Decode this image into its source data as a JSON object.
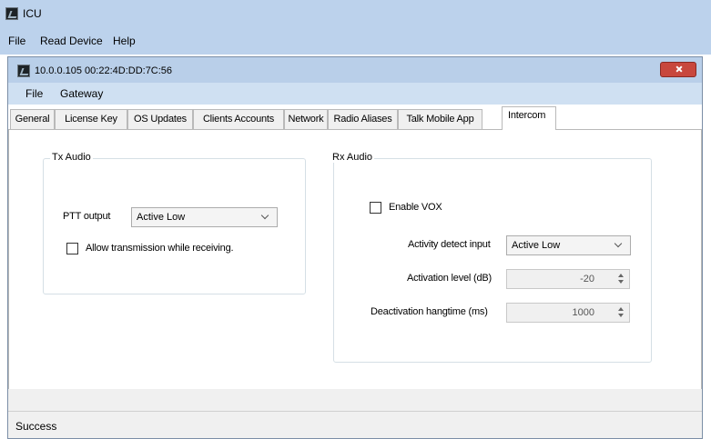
{
  "outer_window": {
    "title": "ICU",
    "menu": [
      "File",
      "Read Device",
      "Help"
    ]
  },
  "inner_window": {
    "title": "10.0.0.105    00:22:4D:DD:7C:56",
    "menu": [
      "File",
      "Gateway"
    ]
  },
  "tabs": [
    {
      "label": "General"
    },
    {
      "label": "License Key"
    },
    {
      "label": "OS Updates"
    },
    {
      "label": "Clients Accounts"
    },
    {
      "label": "Network"
    },
    {
      "label": "Radio Aliases"
    },
    {
      "label": "Talk Mobile App"
    },
    {
      "label": "Intercom",
      "active": true
    }
  ],
  "tx_audio": {
    "title": "Tx Audio",
    "ptt_label": "PTT output",
    "ptt_value": "Active Low",
    "allow_tx_label": "Allow transmission while receiving.",
    "allow_tx_checked": false
  },
  "rx_audio": {
    "title": "Rx Audio",
    "vox_label": "Enable VOX",
    "vox_checked": false,
    "activity_label": "Activity detect input",
    "activity_value": "Active Low",
    "activation_label": "Activation level (dB)",
    "activation_value": "-20",
    "deactivation_label": "Deactivation hangtime (ms)",
    "deactivation_value": "1000"
  },
  "status": {
    "text": "Success"
  },
  "icons": [
    "app-icon",
    "close-icon",
    "chevron-down-icon",
    "spin-up-icon",
    "spin-down-icon"
  ],
  "colors": {
    "title_bar": "#bcd2ec",
    "close_button": "#c8473d"
  }
}
